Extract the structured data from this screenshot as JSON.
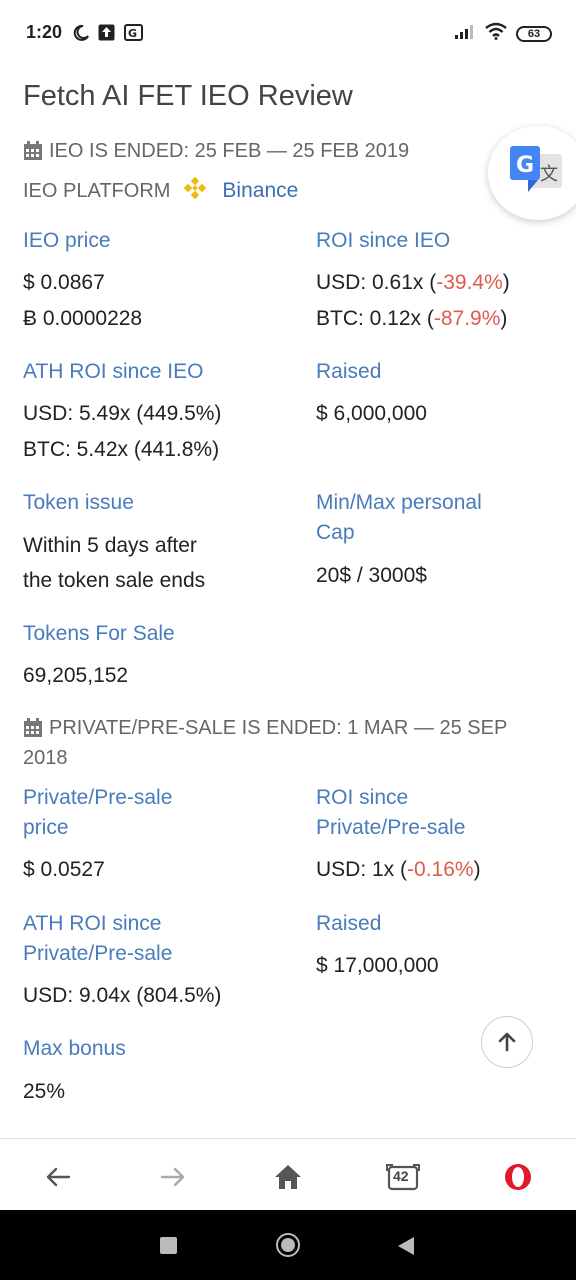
{
  "status_bar": {
    "time": "1:20",
    "battery": "63"
  },
  "title": "Fetch AI FET IEO Review",
  "ieo": {
    "status_text": "IEO IS ENDED: 25 FEB — 25 FEB 2019",
    "platform_label": "IEO PLATFORM",
    "platform_name": "Binance",
    "price_label": "IEO price",
    "price_usd": "$ 0.0867",
    "price_btc": "Ƀ 0.0000228",
    "roi_label": "ROI since IEO",
    "roi_usd_prefix": "USD: 0.61x  (",
    "roi_usd_pct": "-39.4%",
    "roi_usd_suffix": ")",
    "roi_btc_prefix": "BTC: 0.12x  (",
    "roi_btc_pct": "-87.9%",
    "roi_btc_suffix": ")",
    "ath_label": "ATH ROI since IEO",
    "ath_usd": "USD: 5.49x  (449.5%)",
    "ath_btc": "BTC: 5.42x  (441.8%)",
    "raised_label": "Raised",
    "raised_value": "$ 6,000,000",
    "token_issue_label": "Token issue",
    "token_issue_line1": "Within 5 days after",
    "token_issue_line2": "the token sale ends",
    "cap_label_line1": "Min/Max personal",
    "cap_label_line2": "Cap",
    "cap_value": "20$ / 3000$",
    "tokens_label": "Tokens For Sale",
    "tokens_value": "69,205,152"
  },
  "presale": {
    "status_line1": "PRIVATE/PRE-SALE IS ENDED: 1 MAR — 25 SEP",
    "status_line2": "2018",
    "price_label_line1": "Private/Pre-sale",
    "price_label_line2": "price",
    "price_usd": "$ 0.0527",
    "roi_label_line1": "ROI since",
    "roi_label_line2": "Private/Pre-sale",
    "roi_usd_prefix": "USD: 1x  (",
    "roi_usd_pct": "-0.16%",
    "roi_usd_suffix": ")",
    "ath_label_line1": "ATH ROI since",
    "ath_label_line2": "Private/Pre-sale",
    "ath_usd": "USD: 9.04x  (804.5%)",
    "raised_label": "Raised",
    "raised_value": "$ 17,000,000",
    "bonus_label": "Max bonus",
    "bonus_value": "25%"
  },
  "bottom_nav": {
    "tabs_count": "42"
  },
  "colors": {
    "link": "#4a7bbd",
    "negative": "#e05a4e",
    "opera_red": "#e0192a"
  }
}
